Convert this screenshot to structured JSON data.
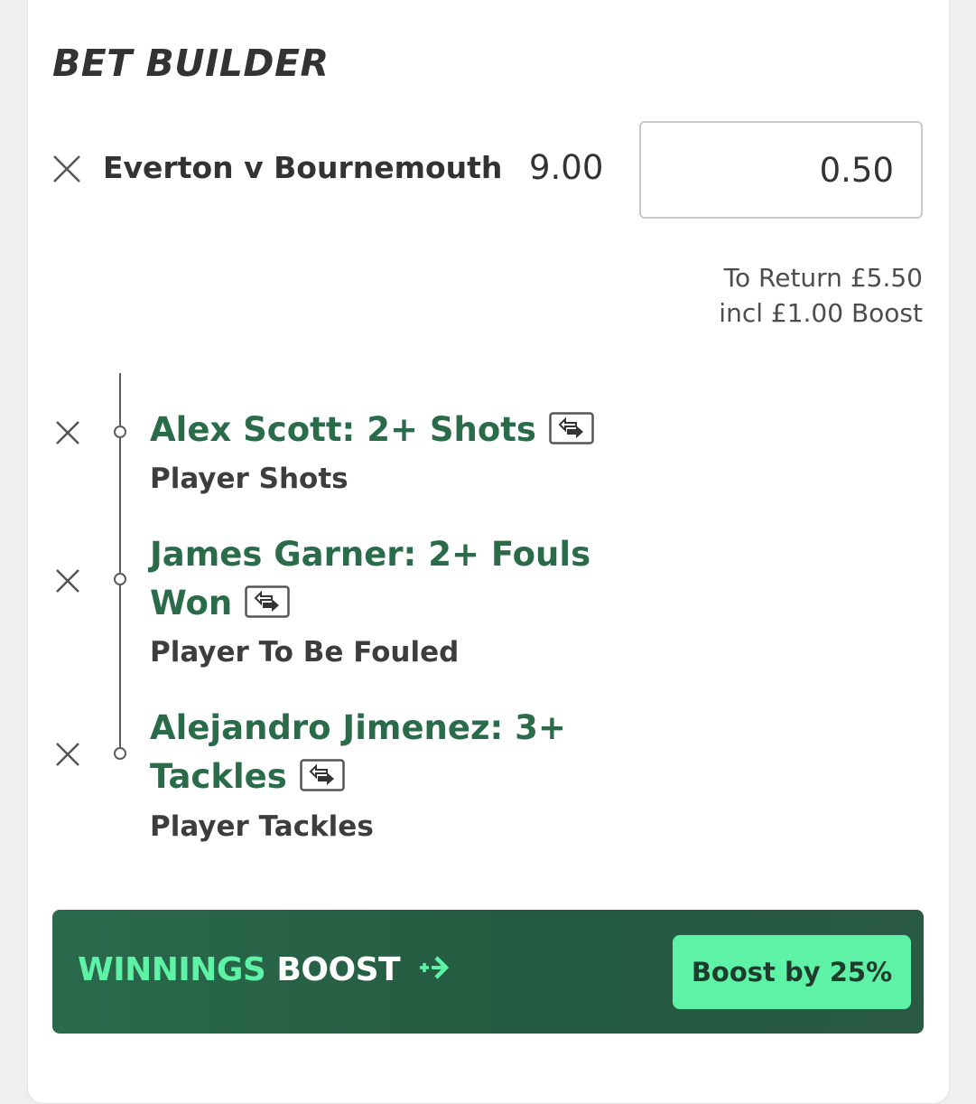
{
  "header": {
    "title": "BET BUILDER"
  },
  "bet": {
    "match": "Everton v Bournemouth",
    "odds": "9.00",
    "stake": "0.50",
    "to_return": "To Return £5.50",
    "boost_included": "incl £1.00 Boost"
  },
  "selections": [
    {
      "name": "Alex Scott: 2+ Shots",
      "market": "Player Shots"
    },
    {
      "name": "James Garner: 2+ Fouls Won",
      "market": "Player To Be Fouled"
    },
    {
      "name": "Alejandro Jimenez: 3+ Tackles",
      "market": "Player Tackles"
    }
  ],
  "boost": {
    "label_part1": "WINNINGS",
    "label_part2": "BOOST",
    "button": "Boost by 25%"
  },
  "colors": {
    "selection_green": "#2a6b4a",
    "boost_accent": "#5ef2a6",
    "boost_bar": "#245a41"
  },
  "icons": {
    "remove": "close-icon",
    "swap": "swap-icon",
    "boost": "boost-arrow-icon"
  }
}
